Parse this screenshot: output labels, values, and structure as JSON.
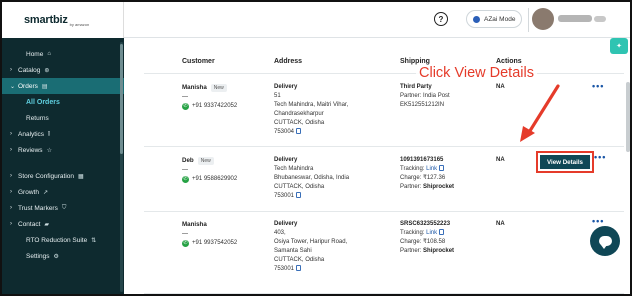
{
  "brand": {
    "logo": "smartbiz",
    "logo_sub": "by amazon"
  },
  "topbar": {
    "help": "?",
    "azai_label": "AZai Mode"
  },
  "sidebar": {
    "home": "Home",
    "catalog": "Catalog",
    "orders": "Orders",
    "all_orders": "All Orders",
    "returns": "Returns",
    "analytics": "Analytics",
    "reviews": "Reviews",
    "store_config": "Store Configuration",
    "growth": "Growth",
    "trust_markers": "Trust Markers",
    "contact": "Contact",
    "rto": "RTO Reduction Suite",
    "settings": "Settings"
  },
  "table": {
    "headers": {
      "customer": "Customer",
      "address": "Address",
      "shipping": "Shipping",
      "actions": "Actions"
    },
    "rows": [
      {
        "name": "Manisha",
        "badge": "New",
        "dash": "—",
        "phone": "+91 9337422052",
        "addr_type": "Delivery",
        "addr_lines": [
          "51",
          "Tech Mahindra, Maitri Vihar,",
          "Chandrasekharpur",
          "CUTTACK, Odisha"
        ],
        "pin": "753004",
        "ship_id": "Third Party",
        "ship_line1": "Partner: India Post",
        "ship_line2": "EK512551212IN",
        "status": "NA"
      },
      {
        "name": "Deb",
        "badge": "New",
        "dash": "—",
        "phone": "+91 9588629902",
        "addr_type": "Delivery",
        "addr_lines": [
          "Tech Mahindra",
          "Bhubaneswar, Odisha, India",
          "CUTTACK, Odisha"
        ],
        "pin": "753001",
        "ship_id": "1091391673165",
        "tracking_label": "Tracking:",
        "tracking_link": "Link",
        "charge": "Charge: ₹127.36",
        "partner": "Partner:",
        "partner_name": "Shiprocket",
        "status": "NA",
        "action": "View Details"
      },
      {
        "name": "Manisha",
        "badge": "",
        "dash": "—",
        "phone": "+91 9937542052",
        "addr_type": "Delivery",
        "addr_lines": [
          "403,",
          "Osiya Tower, Haripur Road,",
          "Samanta Sahi",
          "CUTTACK, Odisha"
        ],
        "pin": "753001",
        "ship_id": "SRSC6323552223",
        "tracking_label": "Tracking:",
        "tracking_link": "Link",
        "charge": "Charge: ₹108.58",
        "partner": "Partner:",
        "partner_name": "Shiprocket",
        "status": "NA"
      }
    ]
  },
  "annotation": {
    "text": "Click View Details"
  },
  "colors": {
    "sidebar_bg": "#0e2a2f",
    "active": "#1a6d74",
    "button": "#0f4756",
    "highlight": "#e53b2a",
    "accent": "#2fc4b2"
  }
}
